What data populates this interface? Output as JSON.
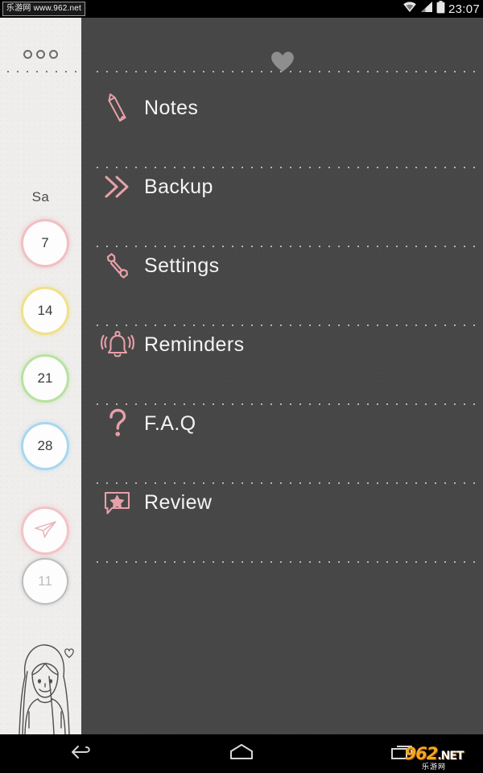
{
  "status_bar": {
    "watermark": "乐游网 www.962.net",
    "clock": "23:07",
    "icons": [
      "wifi-icon",
      "cellular-signal-icon",
      "battery-icon"
    ]
  },
  "sidebar": {
    "overflow_menu": "ooo",
    "weekday_label": "Sa",
    "day_circles": [
      {
        "label": "7",
        "color": "#f0bfc3",
        "color_name": "pink"
      },
      {
        "label": "14",
        "color": "#f0e08a",
        "color_name": "yellow"
      },
      {
        "label": "21",
        "color": "#b7e2a0",
        "color_name": "green"
      },
      {
        "label": "28",
        "color": "#a8d7ef",
        "color_name": "blue"
      },
      {
        "label": "11",
        "color": "#bdbdbd",
        "color_name": "grey"
      }
    ],
    "send_button_icon": "paper-plane-icon",
    "avatar_icon": "girl-avatar-icon",
    "avatar_heart_icon": "heart-outline-icon"
  },
  "menu": {
    "header_icon": "heart-filled-icon",
    "accent_color": "#e8a0a8",
    "items": [
      {
        "label": "Notes",
        "icon": "pencil-icon"
      },
      {
        "label": "Backup",
        "icon": "double-chevron-right-icon"
      },
      {
        "label": "Settings",
        "icon": "wrench-icon"
      },
      {
        "label": "Reminders",
        "icon": "bell-ringing-icon"
      },
      {
        "label": "F.A.Q",
        "icon": "question-mark-icon"
      },
      {
        "label": "Review",
        "icon": "speech-bubble-star-icon"
      }
    ]
  },
  "nav_bar": {
    "buttons": [
      {
        "name": "back",
        "icon": "back-arrow-icon"
      },
      {
        "name": "home",
        "icon": "home-icon"
      },
      {
        "name": "recent",
        "icon": "recent-apps-icon"
      }
    ],
    "logo_main": "962",
    "logo_net": ".NET",
    "logo_sub": "乐游网"
  }
}
